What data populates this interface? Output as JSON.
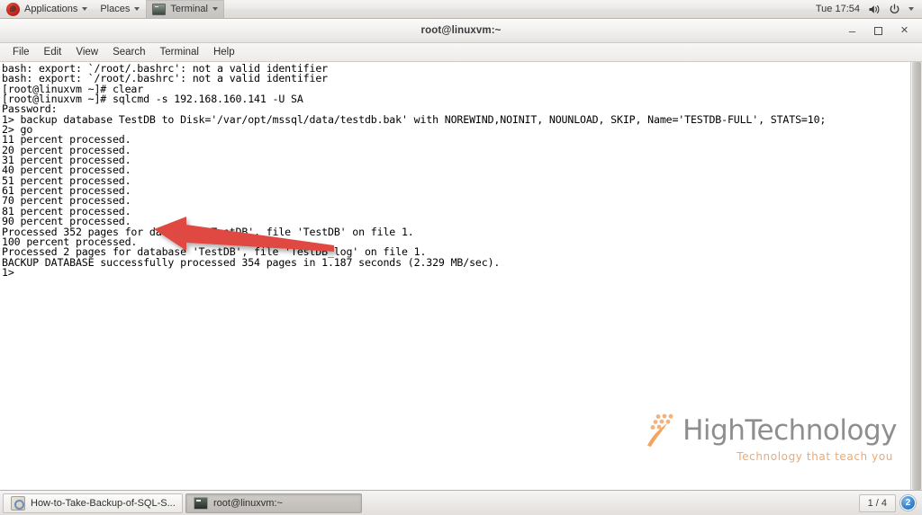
{
  "top_panel": {
    "applications_label": "Applications",
    "places_label": "Places",
    "active_app_label": "Terminal",
    "clock": "Tue 17:54",
    "volume_icon": "speaker-icon",
    "power_icon": "power-icon",
    "menu_caret_icon": "chevron-down-icon",
    "distro_icon": "fedora-logo-icon"
  },
  "terminal_window": {
    "title": "root@linuxvm:~",
    "window_buttons": {
      "minimize": "–",
      "maximize": "□",
      "close": "✕"
    },
    "menus": [
      "File",
      "Edit",
      "View",
      "Search",
      "Terminal",
      "Help"
    ],
    "lines": [
      "bash: export: `/root/.bashrc': not a valid identifier",
      "bash: export: `/root/.bashrc': not a valid identifier",
      "[root@linuxvm ~]# clear",
      "[root@linuxvm ~]# sqlcmd -s 192.168.160.141 -U SA",
      "Password:",
      "1> backup database TestDB to Disk='/var/opt/mssql/data/testdb.bak' with NOREWIND,NOINIT, NOUNLOAD, SKIP, Name='TESTDB-FULL', STATS=10;",
      "2> go",
      "11 percent processed.",
      "20 percent processed.",
      "31 percent processed.",
      "40 percent processed.",
      "51 percent processed.",
      "61 percent processed.",
      "70 percent processed.",
      "81 percent processed.",
      "90 percent processed.",
      "Processed 352 pages for database 'TestDB', file 'TestDB' on file 1.",
      "100 percent processed.",
      "Processed 2 pages for database 'TestDB', file 'TestDB_log' on file 1.",
      "BACKUP DATABASE successfully processed 354 pages in 1.187 seconds (2.329 MB/sec).",
      "1>"
    ]
  },
  "annotation": {
    "arrow_color": "#e04a42",
    "arrow_name": "red-left-arrow-annotation"
  },
  "watermark": {
    "brand": "HighTechnology",
    "tagline": "Technology that teach you",
    "brand_color": "#8e8e8e",
    "accent_color": "#f2a86b"
  },
  "taskbar": {
    "tasks": [
      {
        "label": "How-to-Take-Backup-of-SQL-S...",
        "icon": "document-icon",
        "active": false
      },
      {
        "label": "root@linuxvm:~",
        "icon": "terminal-icon",
        "active": true
      }
    ],
    "workspace": "1 / 4",
    "notification_count": "2"
  }
}
